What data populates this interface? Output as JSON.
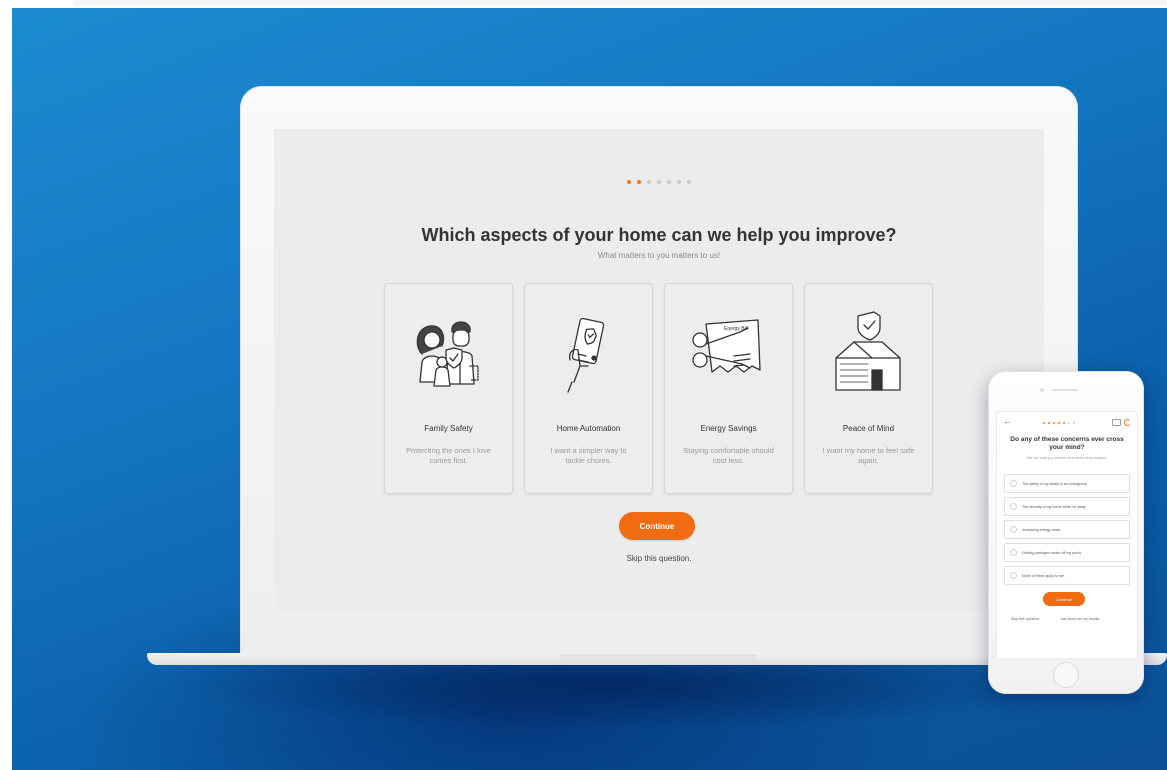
{
  "laptop": {
    "progress": {
      "total": 7,
      "current": 2
    },
    "title": "Which aspects of your home can we help you improve?",
    "subtitle": "What matters to you matters to us!",
    "cards": [
      {
        "title": "Family Safety",
        "desc": "Protecting the ones I love comes first.",
        "icon": "family-icon"
      },
      {
        "title": "Home Automation",
        "desc": "I want a simpler way to tackle chores.",
        "icon": "phone-hand-icon"
      },
      {
        "title": "Energy Savings",
        "desc": "Staying comfortable should cost less.",
        "icon": "energy-bill-scissors-icon",
        "bill_label": "Energy Bill"
      },
      {
        "title": "Peace of Mind",
        "desc": "I want my home to feel safe again.",
        "icon": "house-shield-icon"
      }
    ],
    "continue_label": "Continue",
    "skip_label": "Skip this question."
  },
  "phone": {
    "back_label": "←",
    "progress": {
      "total": 7,
      "current": 5
    },
    "title": "Do any of these concerns ever cross your mind?",
    "subtitle": "We can help you prevent them before they happen.",
    "options": [
      "The safety of my family in an emergency.",
      "The security of my home while I'm away.",
      "Increasing energy costs.",
      "Getting packages stolen off my porch.",
      "None of these apply to me."
    ],
    "continue_label": "Continue",
    "skip_label": "Skip this question.",
    "show_results_label": "Just show me my results."
  },
  "colors": {
    "accent": "#f06b12",
    "background": "#1578c2",
    "screen": "#ececec"
  }
}
